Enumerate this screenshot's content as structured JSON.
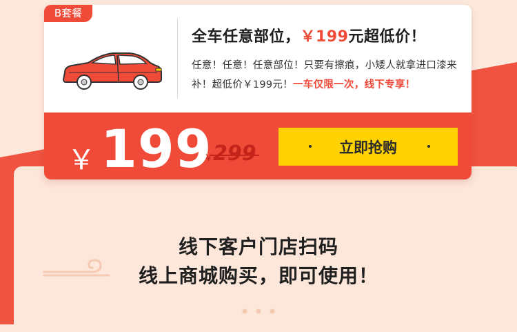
{
  "badge": "B套餐",
  "headline": {
    "prefix": "全车任意部位，",
    "price": "￥199",
    "suffix": "元超低价！"
  },
  "description": {
    "text": "任意！任意！任意部位！只要有擦痕，小矮人就拿进口漆来补！超低价￥199元！",
    "highlight": "一车仅限一次，线下专享！"
  },
  "price": {
    "currency": "￥",
    "current": "199",
    "old_currency": "￥",
    "old": "299"
  },
  "buy_button": {
    "label": "立即抢购"
  },
  "usage": {
    "line1": "线下客户门店扫码",
    "line2": "线上商城购买，即可使用！"
  },
  "colors": {
    "accent": "#f04a38",
    "button": "#ffd100",
    "background": "#fde8dc"
  }
}
